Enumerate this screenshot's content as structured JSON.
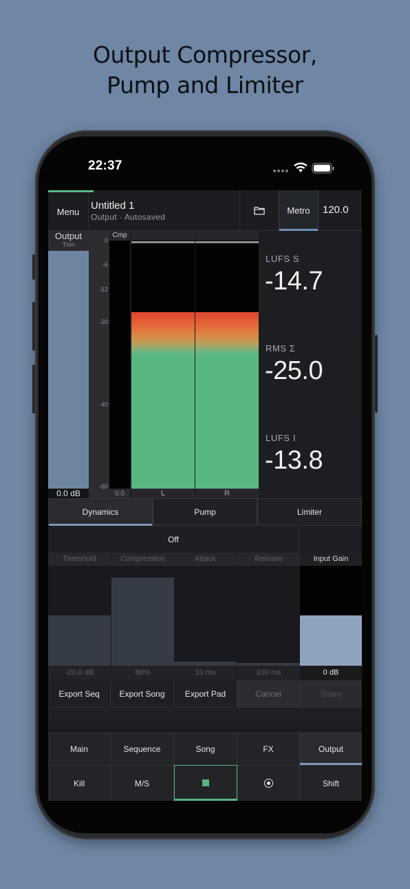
{
  "headline": {
    "line1": "Output Compressor,",
    "line2": "Pump and Limiter"
  },
  "status_bar": {
    "time": "22:37"
  },
  "topbar": {
    "menu_label": "Menu",
    "title": "Untitled 1",
    "subtitle": "Output · Autosaved",
    "metro_label": "Metro",
    "tempo": "120.0"
  },
  "trim": {
    "label": "Output",
    "sublabel": "Trim",
    "value": "0.0 dB"
  },
  "scale": {
    "ticks": [
      "0",
      "-6",
      "-12",
      "-20",
      "-40",
      "-60"
    ],
    "cmp_label": "Cmp",
    "cmp_value": "0.0"
  },
  "meters": {
    "left_label": "L",
    "right_label": "R",
    "level_fraction": 0.71
  },
  "readings": [
    {
      "label": "LUFS S",
      "value": "-14.7"
    },
    {
      "label": "RMS Σ",
      "value": "-25.0"
    },
    {
      "label": "LUFS I",
      "value": "-13.8"
    }
  ],
  "tabs": [
    "Dynamics",
    "Pump",
    "Limiter"
  ],
  "dynamics": {
    "state": "Off",
    "params": [
      {
        "label": "Threshold",
        "value": "-20.0 dB",
        "level": 0.5
      },
      {
        "label": "Compression",
        "value": "88%",
        "level": 0.88
      },
      {
        "label": "Attack",
        "value": "10 ms",
        "level": 0.04
      },
      {
        "label": "Release",
        "value": "100 ms",
        "level": 0.03
      },
      {
        "label": "Input Gain",
        "value": "0 dB",
        "level": 0.5
      }
    ]
  },
  "actions": [
    "Export Seq",
    "Export Song",
    "Export Pad",
    "Cancel",
    "Share"
  ],
  "nav_row1": [
    "Main",
    "Sequence",
    "Song",
    "FX",
    "Output"
  ],
  "nav_row2": {
    "kill": "Kill",
    "ms": "M/S",
    "shift": "Shift"
  },
  "colors": {
    "accent_green": "#58b780",
    "accent_blue": "#7d98ba",
    "meter_red": "#e2452f"
  }
}
